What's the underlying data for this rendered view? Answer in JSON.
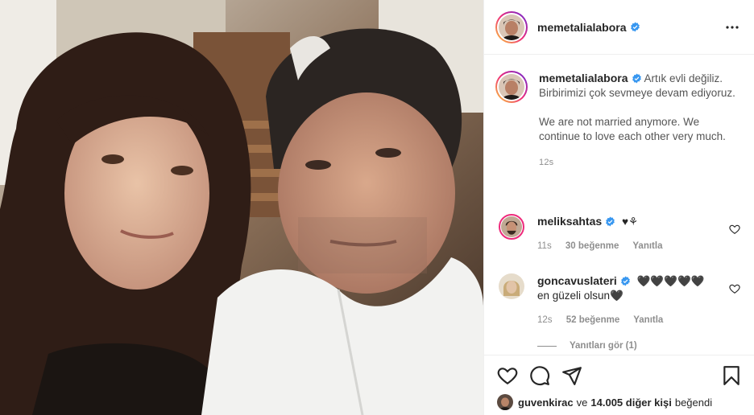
{
  "post": {
    "username": "memetalialabora",
    "caption_username": "memetalialabora",
    "caption_body": "Artık evli değiliz. Birbirimizi çok sevmeye devam ediyoruz.",
    "caption_body_en": "We are not married anymore. We continue to love each other very much.",
    "time": "12s"
  },
  "comments": [
    {
      "username": "meliksahtas",
      "text": "♥⚘",
      "time": "11s",
      "likes": "30 beğenme",
      "reply": "Yanıtla"
    },
    {
      "username": "goncavuslateri",
      "text": "🖤🖤🖤🖤🖤 en güzeli olsun🖤",
      "time": "12s",
      "likes": "52 beğenme",
      "reply": "Yanıtla"
    }
  ],
  "view_replies": "Yanıtları gör (1)",
  "likes": {
    "user": "guvenkirac",
    "connector": "ve",
    "count": "14.005 diğer kişi",
    "suffix": "beğendi"
  },
  "icons": {
    "more": "more-horizontal-icon",
    "like": "heart-icon",
    "comment": "comment-icon",
    "share": "share-icon",
    "save": "bookmark-icon",
    "verified": "verified-badge-icon"
  },
  "colors": {
    "verified": "#3897f0",
    "muted": "#8e8e8e",
    "text": "#262626",
    "divider": "#efefef"
  }
}
